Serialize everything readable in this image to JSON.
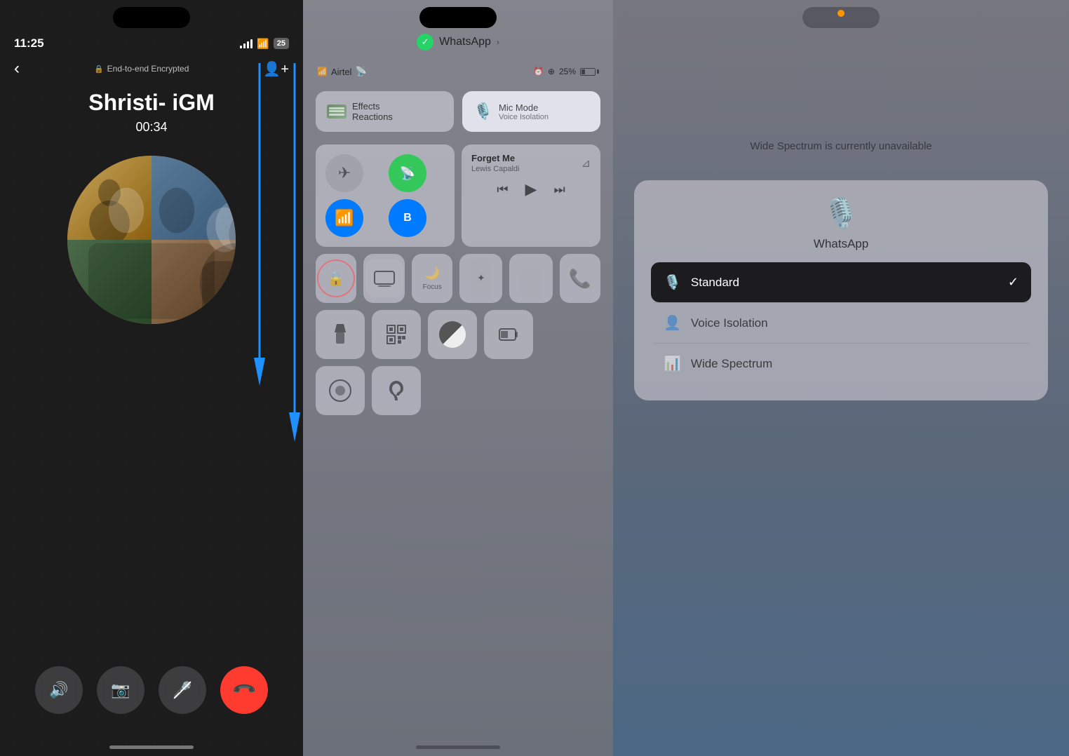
{
  "panel1": {
    "time": "11:25",
    "encryption_label": "End-to-end Encrypted",
    "caller_name": "Shristi- iGM",
    "call_duration": "00:34",
    "battery_level": "25",
    "controls": {
      "speaker": "🔊",
      "video": "📹",
      "mute": "🎤",
      "end_call": "📞"
    }
  },
  "panel2": {
    "carrier": "Airtel",
    "battery": "25%",
    "whatsapp_label": "WhatsApp",
    "effects_label": "Effects",
    "reactions_label": "Reactions",
    "mic_mode_label": "Mic Mode",
    "voice_isolation_label": "Voice Isolation",
    "airplane_mode": "✈",
    "cellular_label": "Cellular",
    "wifi_label": "Wi-Fi",
    "bluetooth_label": "Bluetooth",
    "music_title": "Forget Me",
    "music_artist": "Lewis Capaldi",
    "focus_label": "Focus",
    "flashlight_label": "Flashlight",
    "qr_label": "QR",
    "rotation_lock_label": "Rotation Lock"
  },
  "panel3": {
    "unavailable_text": "Wide Spectrum is currently unavailable",
    "whatsapp_label": "WhatsApp",
    "standard_label": "Standard",
    "voice_isolation_label": "Voice Isolation",
    "wide_spectrum_label": "Wide Spectrum",
    "selected_mode": "Standard"
  }
}
